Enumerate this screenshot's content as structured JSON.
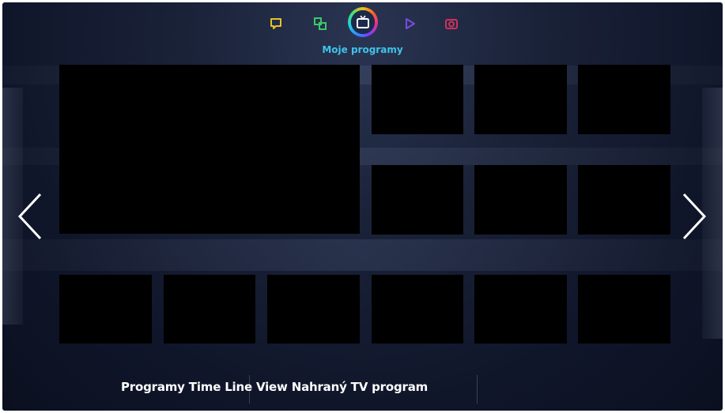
{
  "colors": {
    "accent": "#3fc4ea",
    "background": "#10162a",
    "tile": "#000000",
    "icon_social": "#e8c12a",
    "icon_apps": "#3cc86a",
    "icon_video": "#7a4ce0",
    "icon_photo": "#d0305a"
  },
  "top_nav": {
    "items": [
      {
        "icon": "speech-bubble-icon"
      },
      {
        "icon": "apps-icon"
      },
      {
        "icon": "tv-icon",
        "label": "Moje programy",
        "active": true
      },
      {
        "icon": "play-icon"
      },
      {
        "icon": "camera-icon"
      }
    ],
    "active_label": "Moje programy"
  },
  "arrows": {
    "left": "chevron-left-icon",
    "right": "chevron-right-icon"
  },
  "bottom_menu": {
    "items": [
      "Programy",
      "Time Line View",
      "Nahraný TV program"
    ]
  }
}
